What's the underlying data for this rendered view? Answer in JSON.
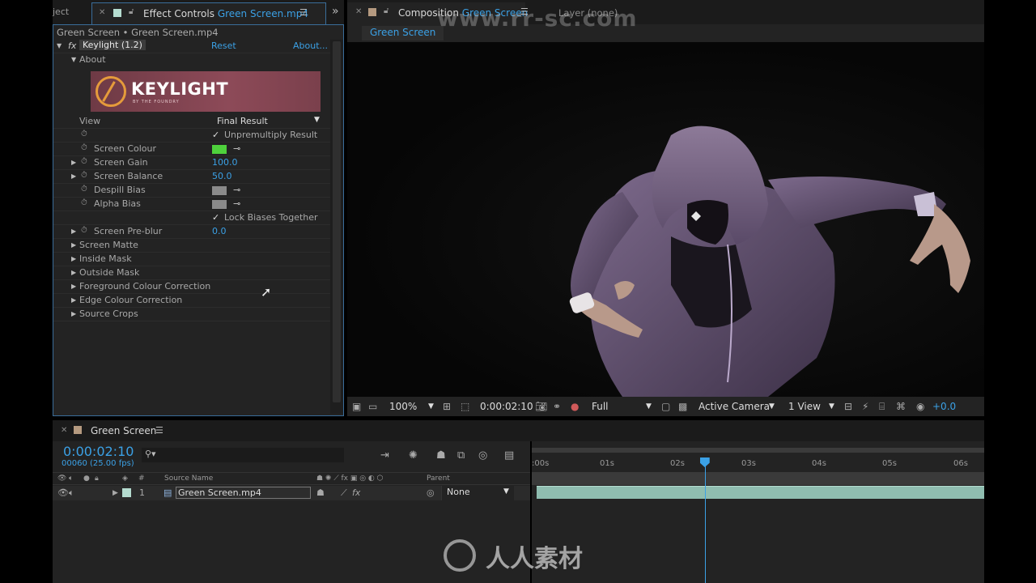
{
  "effect_controls": {
    "prev_tab_label": "ject",
    "tab_prefix": "Effect Controls",
    "tab_layer": "Green Screen.mp4",
    "breadcrumb": "Green Screen • Green Screen.mp4",
    "effect_name": "Keylight (1.2)",
    "reset_label": "Reset",
    "about_link": "About...",
    "about_group": "About",
    "logo_text": "KEYLIGHT",
    "logo_sub": "BY THE FOUNDRY",
    "view_label": "View",
    "view_value": "Final Result",
    "unpremultiply_label": "Unpremultiply Result",
    "screen_colour_label": "Screen Colour",
    "screen_colour_hex": "#4ed13c",
    "screen_gain_label": "Screen Gain",
    "screen_gain_value": "100.0",
    "screen_balance_label": "Screen Balance",
    "screen_balance_value": "50.0",
    "despill_bias_label": "Despill Bias",
    "alpha_bias_label": "Alpha Bias",
    "bias_chip_hex": "#8a8a8a",
    "lock_biases_label": "Lock Biases Together",
    "screen_preblur_label": "Screen Pre-blur",
    "screen_preblur_value": "0.0",
    "groups": [
      "Screen Matte",
      "Inside Mask",
      "Outside Mask",
      "Foreground Colour Correction",
      "Edge Colour Correction",
      "Source Crops"
    ]
  },
  "composition": {
    "tab_prefix": "Composition",
    "tab_name": "Green Screen",
    "layer_tab": "Layer (none)",
    "subtab": "Green Screen",
    "zoom": "100%",
    "timecode": "0:00:02:10",
    "resolution": "Full",
    "camera": "Active Camera",
    "views": "1 View",
    "exposure": "+0.0"
  },
  "timeline": {
    "title": "Green Screen",
    "timecode": "0:00:02:10",
    "frames": "00060 (25.00 fps)",
    "columns": {
      "number": "#",
      "source_name": "Source Name",
      "parent": "Parent"
    },
    "layer": {
      "index": "1",
      "name": "Green Screen.mp4",
      "parent": "None"
    },
    "ruler_labels": [
      ":00s",
      "01s",
      "02s",
      "03s",
      "04s",
      "05s",
      "06s"
    ],
    "current_time_seconds": 2.4
  },
  "watermark": {
    "top": "www.rr-sc.com",
    "bottom": "人人素材"
  },
  "colors": {
    "accent": "#3ba1e6",
    "layer_bar": "#8fbdb0"
  }
}
